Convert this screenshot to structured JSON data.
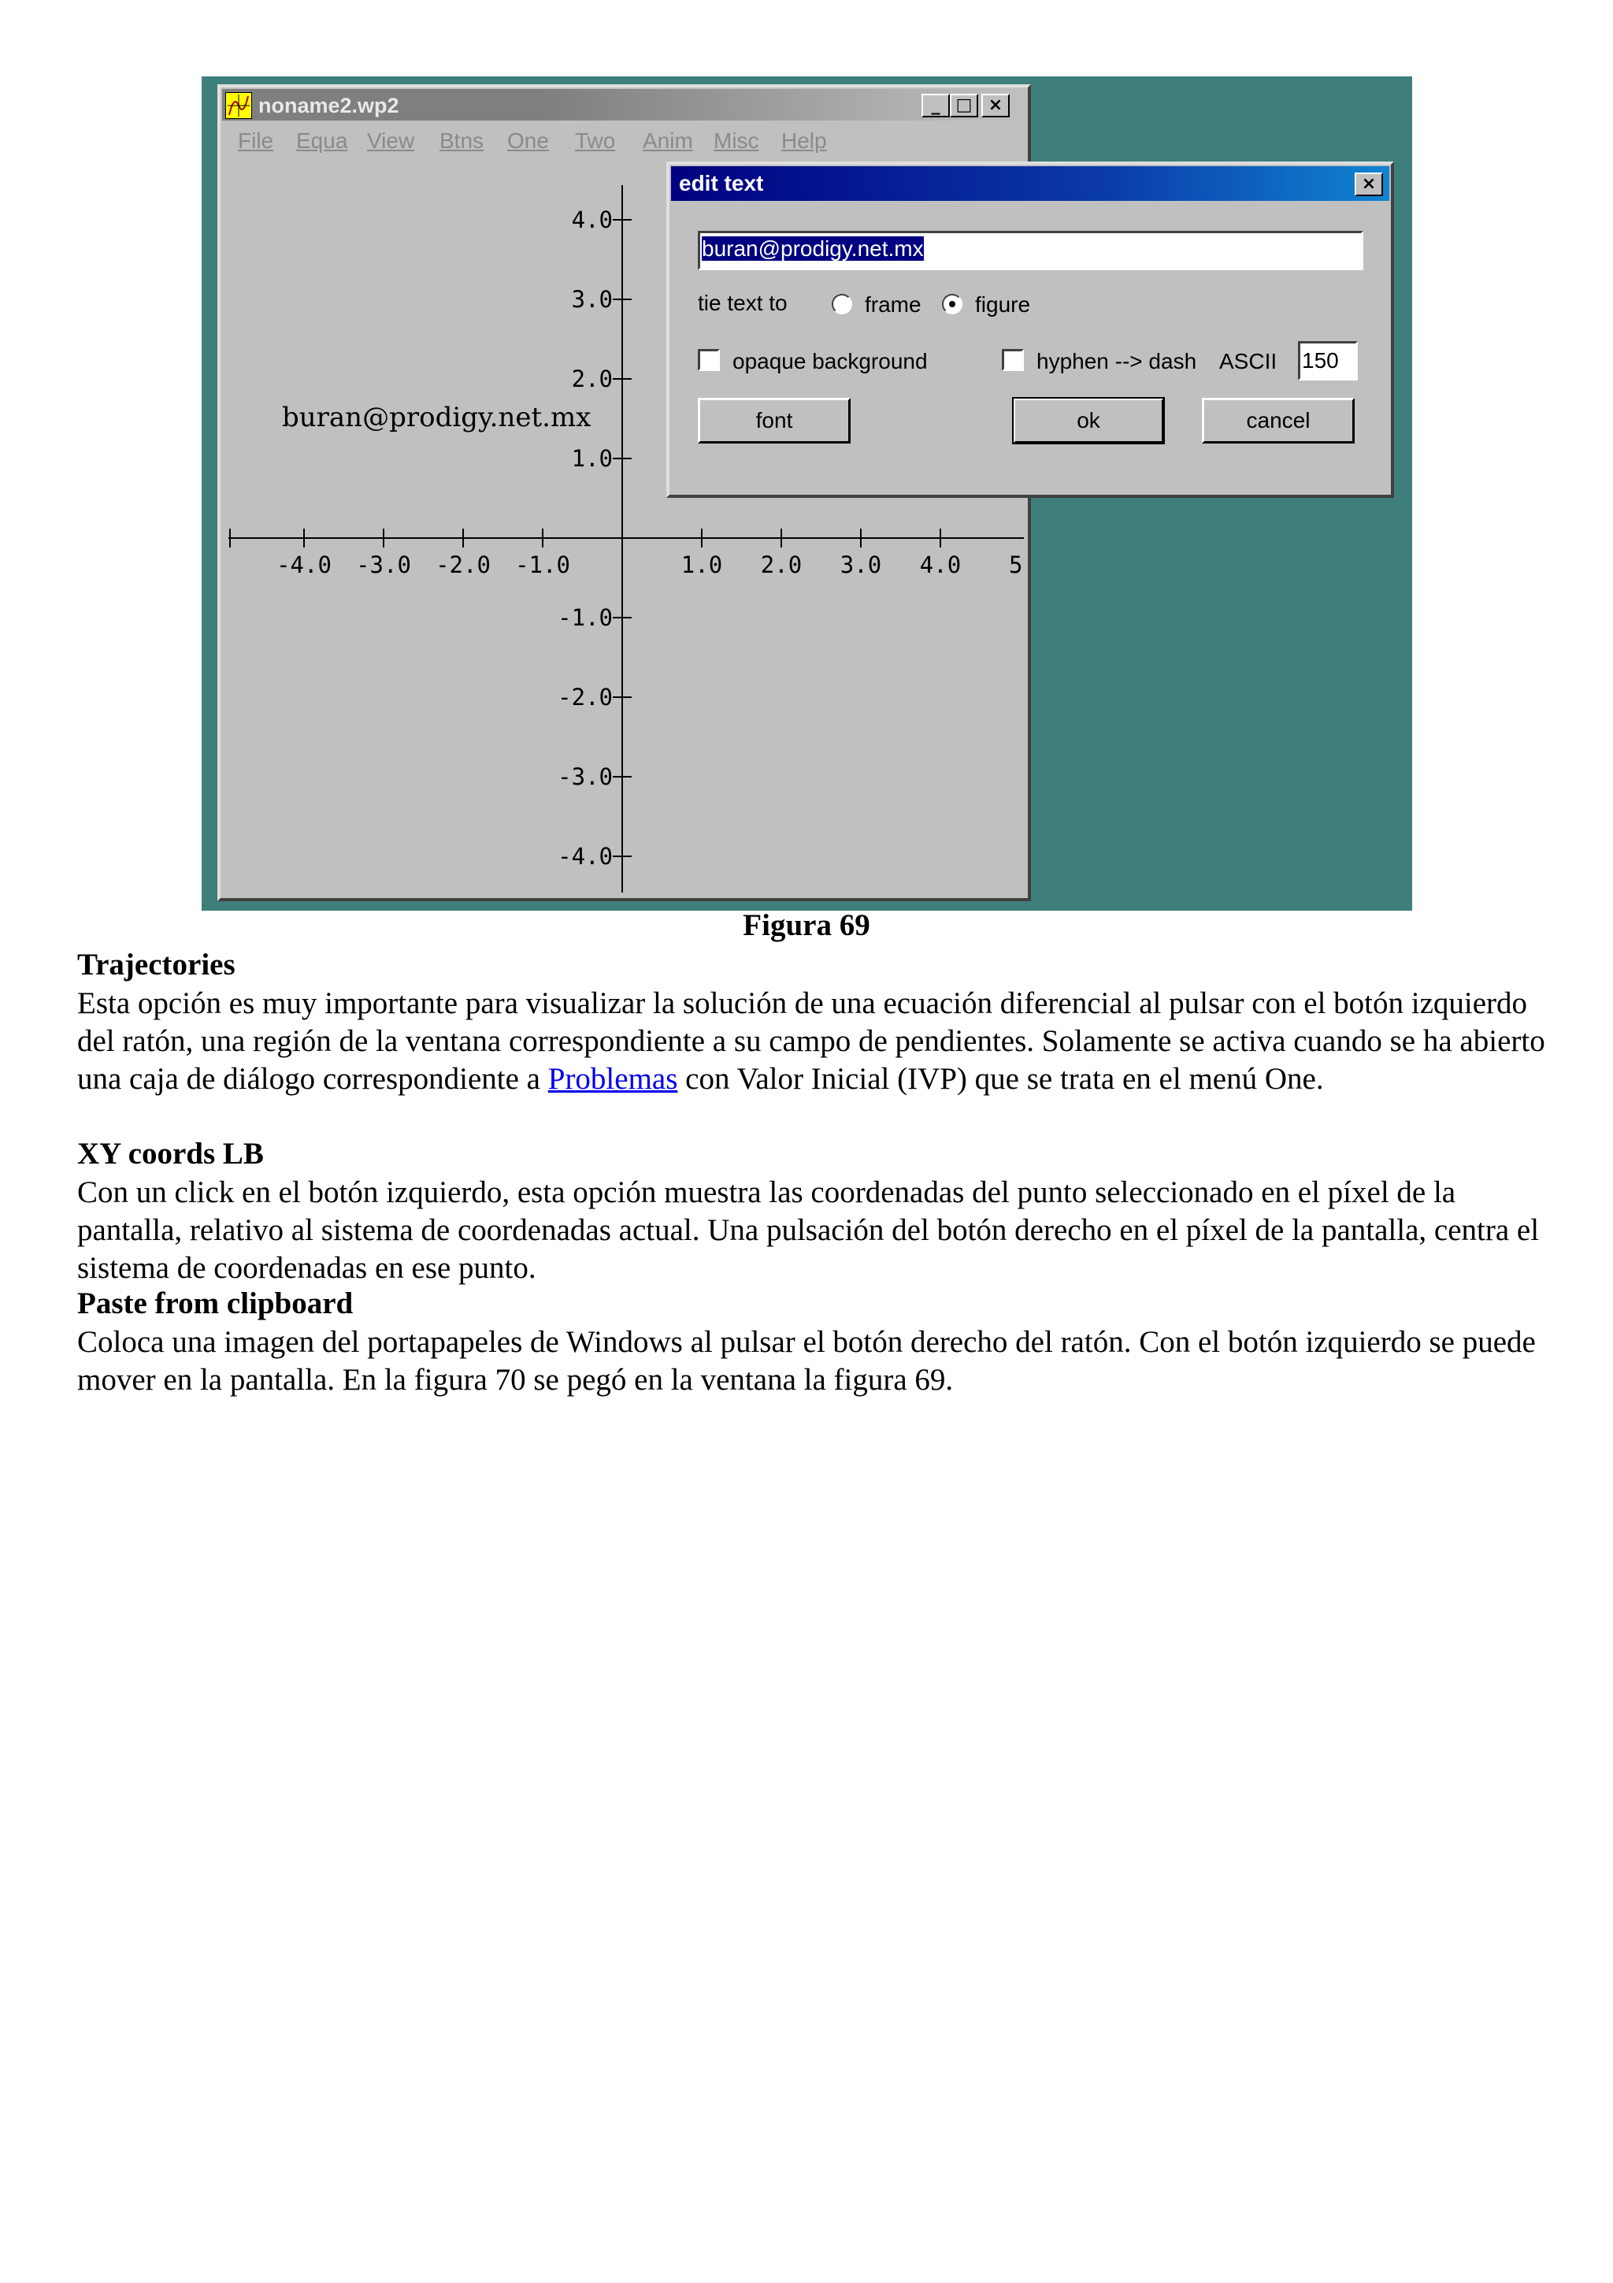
{
  "app_window": {
    "title": "noname2.wp2",
    "buttons": {
      "minimize": "_",
      "maximize": "□",
      "close": "×"
    },
    "menu": [
      "File",
      "Equa",
      "View",
      "Btns",
      "One",
      "Two",
      "Anim",
      "Misc",
      "Help"
    ]
  },
  "plot": {
    "x_ticks": [
      "-4.0",
      "-3.0",
      "-2.0",
      "-1.0",
      "1.0",
      "2.0",
      "3.0",
      "4.0",
      "5."
    ],
    "y_ticks": [
      "4.0",
      "3.0",
      "2.0",
      "1.0",
      "-1.0",
      "-2.0",
      "-3.0",
      "-4.0"
    ],
    "annotation": "buran@prodigy.net.mx"
  },
  "dialog": {
    "title": "edit text",
    "close": "×",
    "text_value": "buran@prodigy.net.mx",
    "tie_label": "tie text to",
    "radio_frame": "frame",
    "radio_figure": "figure",
    "selected_radio": "figure",
    "opaque_label": "opaque background",
    "hyphen_label": "hyphen --> dash",
    "ascii_label": "ASCII",
    "ascii_value": "150",
    "btn_font": "font",
    "btn_ok": "ok",
    "btn_cancel": "cancel"
  },
  "document": {
    "caption": "Figura 69",
    "sections": [
      {
        "heading": "Trajectories",
        "text_before": "Esta opción es muy importante para visualizar la solución de una ecuación diferencial al pulsar con el botón izquierdo del ratón, una región de la ventana correspondiente a su campo de pendientes. Solamente se activa cuando se ha abierto una caja de diálogo correspondiente a ",
        "link": "Problemas",
        "text_after": " con Valor Inicial (IVP) que se trata en el menú One."
      },
      {
        "heading": "XY coords LB",
        "text": "Con un click en el botón izquierdo, esta opción muestra las coordenadas del punto seleccionado en el píxel de la pantalla, relativo al sistema de coordenadas actual. Una pulsación del botón derecho en el píxel de la pantalla, centra el sistema de coordenadas en ese punto."
      },
      {
        "heading": "Paste from clipboard",
        "text": "Coloca una imagen del portapapeles de Windows al pulsar el botón derecho del ratón. Con el botón izquierdo se puede mover en la pantalla. En la figura 70 se pegó en la ventana la figura 69."
      }
    ]
  }
}
